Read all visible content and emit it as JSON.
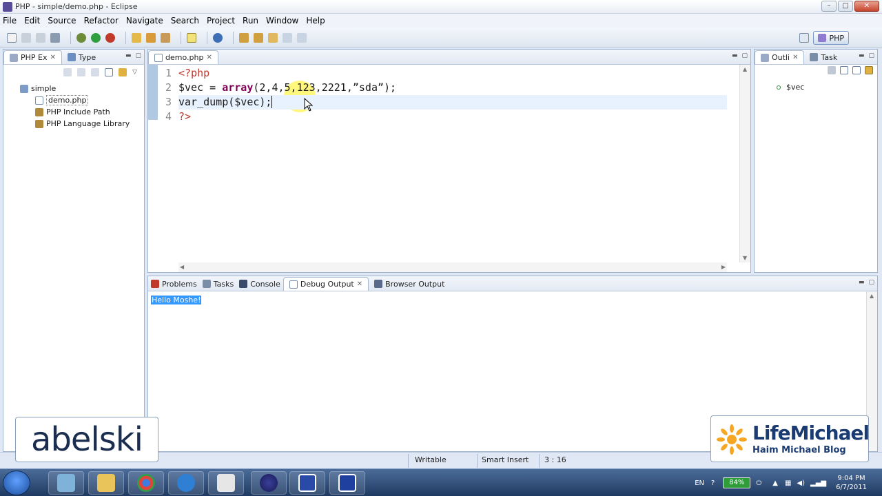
{
  "window": {
    "title": "PHP - simple/demo.php - Eclipse",
    "controls": [
      "–",
      "□",
      "✕"
    ]
  },
  "menu": [
    "File",
    "Edit",
    "Source",
    "Refactor",
    "Navigate",
    "Search",
    "Project",
    "Run",
    "Window",
    "Help"
  ],
  "perspective": {
    "label": "PHP"
  },
  "explorer": {
    "tabs": [
      {
        "label": "PHP Ex",
        "close": "✕"
      },
      {
        "label": "Type"
      }
    ],
    "tree": [
      {
        "label": "simple",
        "level": 0
      },
      {
        "label": "demo.php",
        "level": 1,
        "selected": true
      },
      {
        "label": "PHP Include Path",
        "level": 1
      },
      {
        "label": "PHP Language Library",
        "level": 1
      }
    ]
  },
  "editor": {
    "tab": {
      "label": "demo.php",
      "close": "✕"
    },
    "line_numbers": [
      "1",
      "2",
      "3",
      "4"
    ],
    "lines": {
      "l1": "<?php",
      "l2_a": "$vec = ",
      "l2_kw": "array",
      "l2_b": "(2,4,5,123,2221,",
      "l2_str": "”sda”",
      "l2_c": ");",
      "l3": "var_dump($vec);",
      "l4": "?>"
    }
  },
  "outline": {
    "tabs": [
      {
        "label": "Outli",
        "close": "✕"
      },
      {
        "label": "Task"
      }
    ],
    "items": [
      "$vec"
    ]
  },
  "bottom": {
    "tabs": [
      {
        "label": "Problems"
      },
      {
        "label": "Tasks"
      },
      {
        "label": "Console"
      },
      {
        "label": "Debug Output",
        "close": "✕"
      },
      {
        "label": "Browser Output"
      }
    ],
    "output": "Hello Moshe!"
  },
  "status": {
    "writable": "Writable",
    "insert_mode": "Smart Insert",
    "position": "3 : 16"
  },
  "overlays": {
    "left_logo": "abelski",
    "right_logo_title": "LifeMichael",
    "right_logo_subtitle": "Haim Michael Blog"
  },
  "taskbar": {
    "lang": "EN",
    "battery": "84%",
    "time": "9:04 PM",
    "date": "6/7/2011"
  },
  "colors": {
    "output_highlight": "#3399ff",
    "accent": "#1b3c72",
    "cursor_highlight": "#fff550"
  }
}
